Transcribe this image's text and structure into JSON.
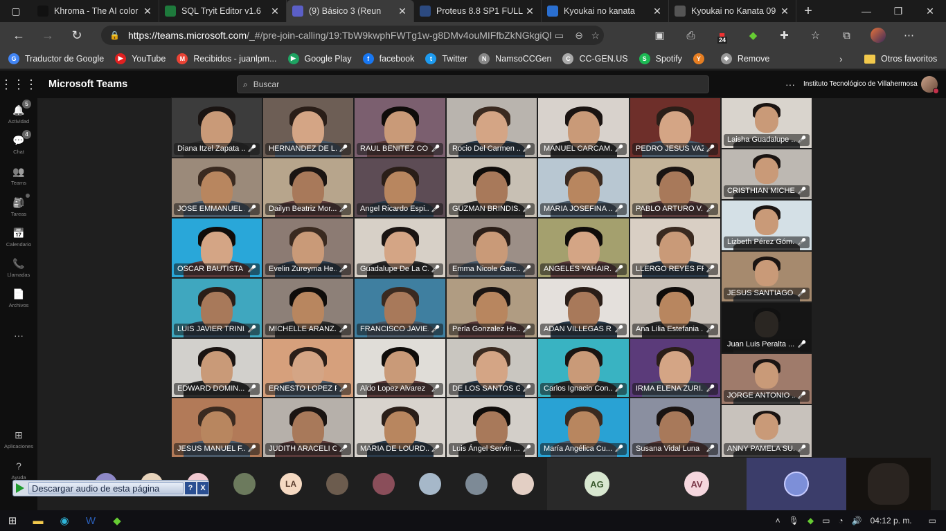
{
  "browser": {
    "tabs": [
      {
        "label": "Khroma - The AI color",
        "fav_bg": "#111"
      },
      {
        "label": "SQL Tryit Editor v1.6",
        "fav_bg": "#1e7a3c"
      },
      {
        "label": "(9) Básico 3 (Reun",
        "fav_bg": "#5b5fc7"
      },
      {
        "label": "Proteus 8.8 SP1 FULL",
        "fav_bg": "#2c4a80"
      },
      {
        "label": "Kyoukai no kanata",
        "fav_bg": "#2a6fd0"
      },
      {
        "label": "Kyoukai no Kanata 09",
        "fav_bg": "#555"
      }
    ],
    "url_host": "https://teams.microsoft.com",
    "url_path": "/_#/pre-join-calling/19:TbW9kwphFWTg1w-g8DMv4ouMIFfbZkNGkgiQhjk...",
    "ext_badge": "24",
    "bookmarks": [
      {
        "label": "Traductor de Google",
        "color": "#4285f4",
        "glyph": "G"
      },
      {
        "label": "YouTube",
        "color": "#e02020",
        "glyph": "▶"
      },
      {
        "label": "Recibidos - juanlpm...",
        "color": "#ea4335",
        "glyph": "M"
      },
      {
        "label": "Google Play",
        "color": "#1ea362",
        "glyph": "▶"
      },
      {
        "label": "facebook",
        "color": "#1877f2",
        "glyph": "f"
      },
      {
        "label": "Twitter",
        "color": "#1d9bf0",
        "glyph": "t"
      },
      {
        "label": "NamsoCCGen",
        "color": "#888",
        "glyph": "N"
      },
      {
        "label": "CC-GEN.US",
        "color": "#aaa",
        "glyph": "C"
      },
      {
        "label": "Spotify",
        "color": "#1db954",
        "glyph": "S"
      },
      {
        "label": "",
        "color": "#e67e22",
        "glyph": "Y"
      },
      {
        "label": "Remove",
        "color": "#999",
        "glyph": "◆"
      }
    ],
    "other_favorites": "Otros favoritos"
  },
  "teams": {
    "app_title": "Microsoft Teams",
    "search_placeholder": "Buscar",
    "org": "Instituto Tecnológico de Villahermosa",
    "rail": [
      {
        "label": "Actividad",
        "icon": "bell-icon",
        "glyph": "🔔",
        "badge": "5"
      },
      {
        "label": "Chat",
        "icon": "chat-icon",
        "glyph": "💬",
        "badge": "4"
      },
      {
        "label": "Teams",
        "icon": "teams-icon",
        "glyph": "👥",
        "badge": ""
      },
      {
        "label": "Tareas",
        "icon": "tasks-icon",
        "glyph": "🎒",
        "badge": "dot"
      },
      {
        "label": "Calendario",
        "icon": "calendar-icon",
        "glyph": "📅",
        "badge": ""
      },
      {
        "label": "Llamadas",
        "icon": "phone-icon",
        "glyph": "📞",
        "badge": ""
      },
      {
        "label": "Archivos",
        "icon": "files-icon",
        "glyph": "📄",
        "badge": ""
      },
      {
        "label": "...",
        "icon": "more-icon",
        "glyph": "",
        "badge": ""
      },
      {
        "label": "Aplicaciones",
        "icon": "apps-icon",
        "glyph": "⊞",
        "badge": ""
      },
      {
        "label": "Ayuda",
        "icon": "help-icon",
        "glyph": "?",
        "badge": ""
      }
    ],
    "participants_main": [
      [
        "Diana Itzel Zapata ...",
        "HERNANDEZ DE L...",
        "RAUL BENITEZ CO...",
        "Rocio Del Carmen ...",
        "MANUEL CARCAM...",
        "PEDRO JESUS VAZ..."
      ],
      [
        "JOSE EMMANUEL ...",
        "Dailyn Beatriz Mor...",
        "Angel Ricardo Espi...",
        "GUZMAN BRINDIS...",
        "MARIA JOSEFINA ...",
        "PABLO ARTURO V..."
      ],
      [
        "OSCAR BAUTISTA ...",
        "Evelin Zureyma He...",
        "Guadalupe De La C...",
        "Emma Nicole Garc...",
        "ANGELES YAHAIR...",
        "LLERGO REYES FR..."
      ],
      [
        "LUIS JAVIER TRINI...",
        "MICHELLE ARANZ...",
        "FRANCISCO JAVIE...",
        "Perla Gonzalez He...",
        "ADAN VILLEGAS R...",
        "Ana Lilia Estefania ..."
      ],
      [
        "EDWARD DOMIN...",
        "ERNESTO LOPEZ R...",
        "Aldo Lopez Alvarez",
        "DE LOS SANTOS G...",
        "Carlos Ignacio Con...",
        "IRMA ELENA ZURI..."
      ],
      [
        "JESUS MANUEL F...",
        "JUDITH ARACELI C...",
        "MARIA DE LOURD...",
        "Luis Ángel Servin ...",
        "María Angélica Cu...",
        "Susana Vidal Luna"
      ]
    ],
    "participants_side": [
      "Laisha Guadalupe ...",
      "CRISTHIAN MICHE...",
      "Lizbeth Pérez Góm...",
      "JESUS SANTIAGO ...",
      "Juan Luis Peralta ...",
      "JORGE ANTONIO ...",
      "ANNY PAMELA SU..."
    ],
    "tile_bgs": [
      [
        "#3c3c3c",
        "#6d5e55",
        "#7b5f6f",
        "#b9b4ae",
        "#d8d2cc",
        "#6e2f2a"
      ],
      [
        "#9b8a7a",
        "#b7a58c",
        "#5d4c55",
        "#c8c0b4",
        "#b8c7d2",
        "#c4b49a"
      ],
      [
        "#29a7d9",
        "#8c7b73",
        "#d7d0c7",
        "#9c8f87",
        "#a4a06e",
        "#d9cfc4"
      ],
      [
        "#3fa7bf",
        "#8d8078",
        "#3f7fa0",
        "#b09c82",
        "#e4e0dc",
        "#c9c1b8"
      ],
      [
        "#d2d0cc",
        "#d6a07c",
        "#e0ddd8",
        "#c9c6c0",
        "#39b3c2",
        "#5b3b7a"
      ],
      [
        "#b27a58",
        "#b6b0aa",
        "#d8d3cd",
        "#d3cfc9",
        "#29a2d4",
        "#8a8fa0"
      ]
    ],
    "side_bgs": [
      "#d9d4cd",
      "#bdb8b2",
      "#d4e0e6",
      "#a68a6e",
      "#151515",
      "#9f7b6b",
      "#c8c2bc"
    ],
    "bottom_avatars": [
      {
        "initials": "",
        "color": "#8e88c7"
      },
      {
        "initials": "",
        "color": "#e7d3bb"
      },
      {
        "initials": "",
        "color": "#f0c8cf"
      },
      {
        "initials": "",
        "color": "#6c7a5d"
      },
      {
        "initials": "LA",
        "color": "#f5d9c2"
      },
      {
        "initials": "",
        "color": "#6c5c4e"
      },
      {
        "initials": "",
        "color": "#8a4e5a"
      },
      {
        "initials": "",
        "color": "#a6b8c9"
      },
      {
        "initials": "",
        "color": "#7d8a96"
      },
      {
        "initials": "",
        "color": "#e3cfc4"
      }
    ],
    "big_tiles": [
      {
        "initials": "AG",
        "color": "#d8e7d0",
        "text_color": "#3a5a2e"
      },
      {
        "initials": "AV",
        "color": "#f5d7de",
        "text_color": "#7a3848"
      },
      {
        "initials": "",
        "color": "#7d8fd8",
        "text_color": "#fff"
      },
      {
        "initials": "",
        "color": "#1a1612",
        "text_color": "#fff"
      }
    ],
    "download_label": "Descargar audio de esta página",
    "download_help": "?",
    "download_close": "X"
  },
  "taskbar": {
    "time": "04:12 p. m."
  }
}
